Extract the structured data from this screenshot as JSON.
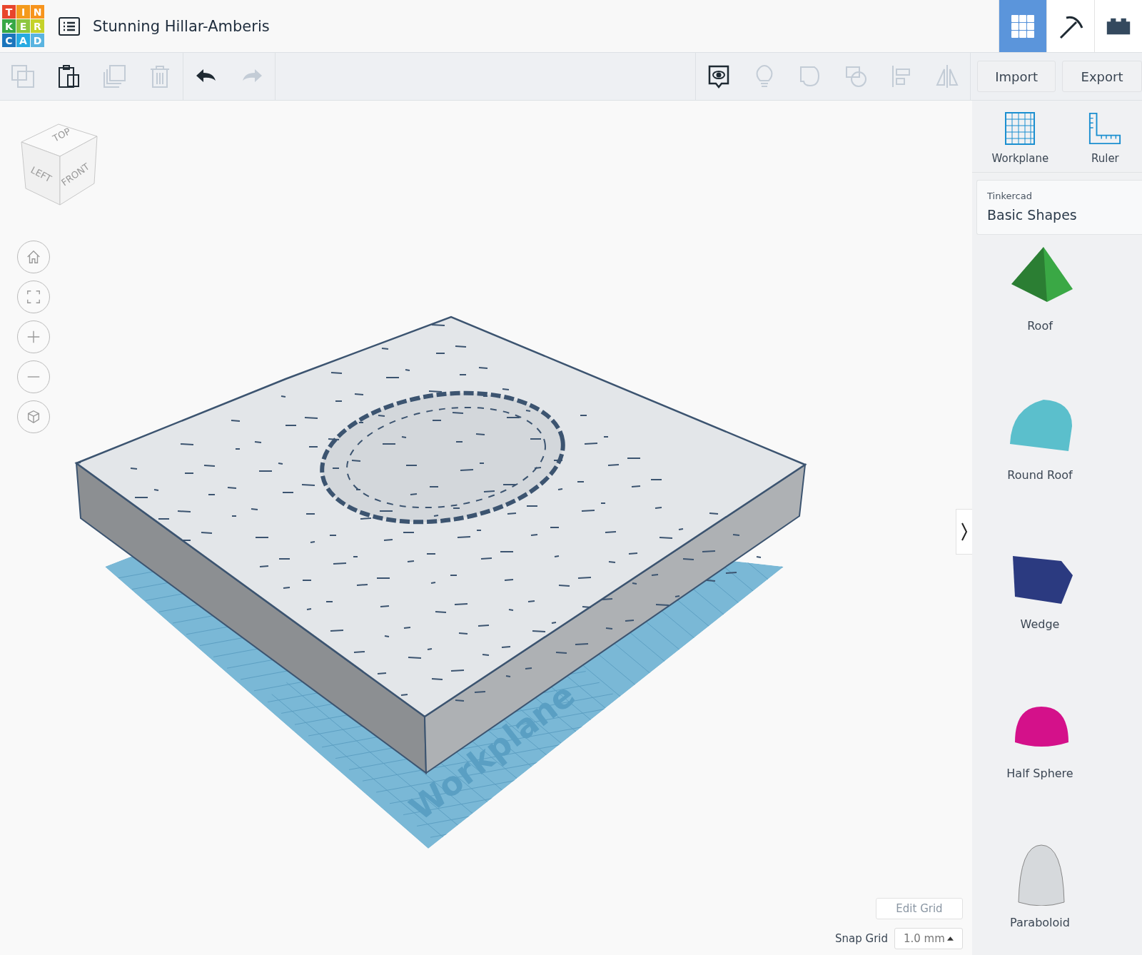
{
  "header": {
    "logo_letters": [
      "T",
      "I",
      "N",
      "K",
      "E",
      "R",
      "C",
      "A",
      "D"
    ],
    "title": "Stunning Hillar-Amberis",
    "views": [
      {
        "kind": "grid",
        "selected": true
      },
      {
        "kind": "pickaxe",
        "selected": false
      },
      {
        "kind": "brick",
        "selected": false
      }
    ]
  },
  "toolbar": {
    "left_tools": [
      {
        "kind": "copy",
        "disabled": true
      },
      {
        "kind": "paste",
        "disabled": false
      },
      {
        "kind": "duplicate",
        "disabled": true
      },
      {
        "kind": "delete",
        "disabled": true
      }
    ],
    "history_tools": [
      {
        "kind": "undo",
        "disabled": false
      },
      {
        "kind": "redo",
        "disabled": true
      }
    ],
    "right_tools": [
      {
        "kind": "notes",
        "disabled": false
      },
      {
        "kind": "bulb",
        "disabled": true
      },
      {
        "kind": "group",
        "disabled": true
      },
      {
        "kind": "ungroup",
        "disabled": true
      },
      {
        "kind": "align",
        "disabled": true
      },
      {
        "kind": "mirror",
        "disabled": true
      }
    ],
    "buttons": [
      "Import",
      "Export"
    ]
  },
  "view_cube": {
    "top": "TOP",
    "left": "LEFT",
    "front": "FRONT"
  },
  "nav_controls": [
    {
      "kind": "home"
    },
    {
      "kind": "fit"
    },
    {
      "kind": "zoom_in"
    },
    {
      "kind": "zoom_out"
    },
    {
      "kind": "perspective"
    }
  ],
  "workplane_label": "Workplane",
  "grid_controls": {
    "edit_button": "Edit Grid",
    "snap_label": "Snap Grid",
    "snap_value": "1.0 mm"
  },
  "panel": {
    "tools": [
      {
        "kind": "workplane",
        "label": "Workplane"
      },
      {
        "kind": "ruler",
        "label": "Ruler"
      }
    ],
    "library_source": "Tinkercad",
    "library_name": "Basic Shapes",
    "shapes": [
      {
        "kind": "roof",
        "label": "Roof",
        "color": "#3aa845"
      },
      {
        "kind": "round_roof",
        "label": "Round Roof",
        "color": "#5bbfcc"
      },
      {
        "kind": "wedge",
        "label": "Wedge",
        "color": "#2b3a80"
      },
      {
        "kind": "half_sphere",
        "label": "Half Sphere",
        "color": "#d4118a"
      },
      {
        "kind": "paraboloid",
        "label": "Paraboloid",
        "color": "#d6d9dc"
      }
    ]
  }
}
